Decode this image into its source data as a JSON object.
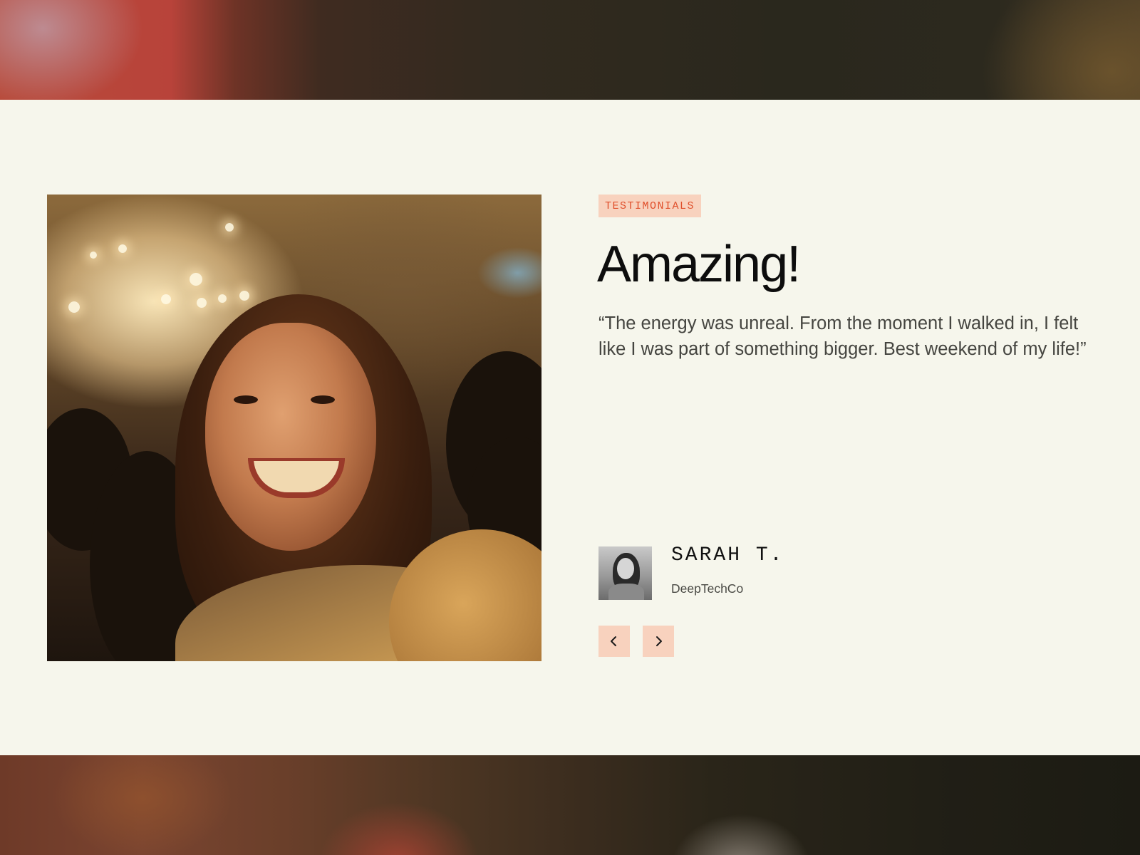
{
  "testimonial": {
    "tag": "TESTIMONIALS",
    "heading": "Amazing!",
    "quote": "“The energy was unreal. From the moment I walked in, I felt like I was part of something bigger. Best weekend of my life!”",
    "author_name": "SARAH T.",
    "author_company": "DeepTechCo"
  },
  "navigation": {
    "prev_icon": "chevron-left-icon",
    "next_icon": "chevron-right-icon"
  },
  "colors": {
    "section_background": "#f6f6ec",
    "tag_background": "#f8d2be",
    "tag_text": "#e0502c",
    "nav_button_background": "#f8d2be",
    "heading_text": "#0d0d0d",
    "quote_text": "#454540"
  }
}
